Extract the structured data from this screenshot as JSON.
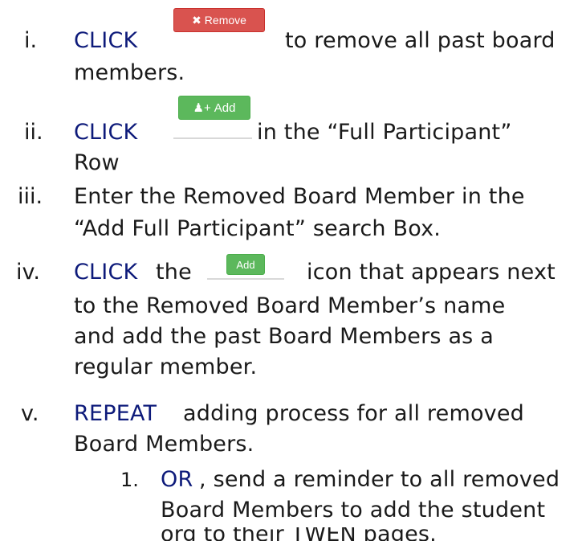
{
  "steps": [
    {
      "numeral": "i.",
      "keyword": "CLICK",
      "button_label": "Remove",
      "button_icon": "close-icon",
      "text_after": "to remove all past board",
      "text_cont": "members."
    },
    {
      "numeral": "ii.",
      "keyword": "CLICK",
      "button_label": "Add",
      "button_icon": "add-user-icon",
      "text_after": "in the “Full Participant”",
      "text_cont": "Row"
    },
    {
      "numeral": "iii.",
      "line1": "Enter the Removed Board Member in the",
      "line2": "“Add Full Participant” search Box."
    },
    {
      "numeral": "iv.",
      "keyword": "CLICK",
      "text_before": "the",
      "button_label": "Add",
      "text_after": "icon that appears next",
      "line2": "to the Removed Board Member’s name",
      "line3": "and add the past Board Members as a",
      "line4": "regular member."
    },
    {
      "numeral": "v.",
      "keyword": "REPEAT",
      "text_after": "adding process for all removed",
      "line2": "Board Members."
    }
  ],
  "substep": {
    "numeral": "1.",
    "keyword": "OR",
    "text_after": ", send a reminder to all removed",
    "line2": "Board Members to add the student",
    "line3": "org to their TWEN pages."
  },
  "colors": {
    "keyword": "#0d1a7a",
    "remove_button": "#d9534f",
    "add_button": "#5cb85c"
  }
}
